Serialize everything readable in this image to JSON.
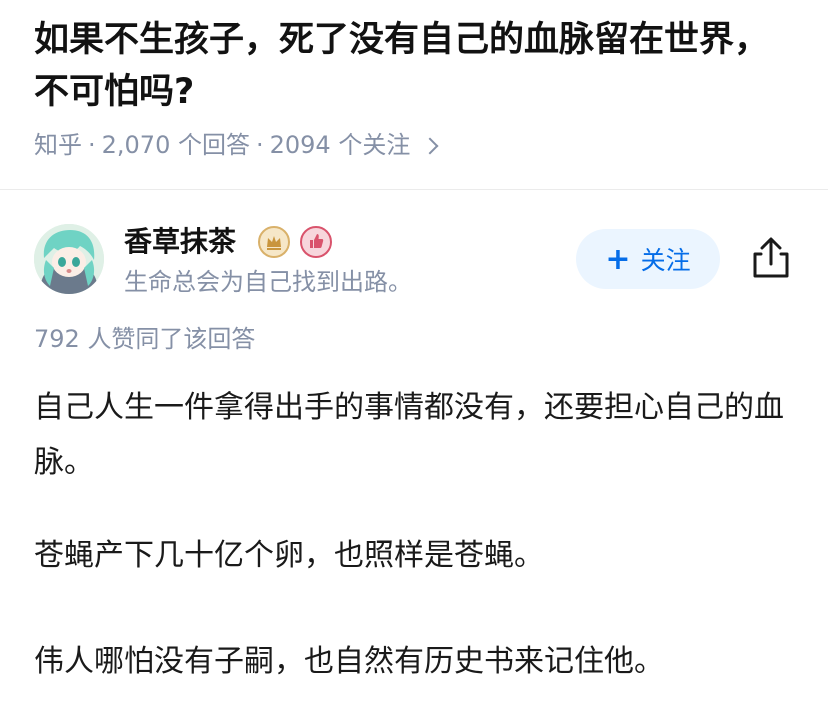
{
  "question": {
    "title": "如果不生孩子，死了没有自己的血脉留在世界，不可怕吗?",
    "source": "知乎",
    "answer_count": "2,070 个回答",
    "follow_count": "2094 个关注",
    "separator": "·"
  },
  "author": {
    "name": "香草抹茶",
    "bio": "生命总会为自己找到出路。",
    "badges": [
      "crown-badge-icon",
      "thumb-badge-icon"
    ]
  },
  "actions": {
    "follow_label": "关注",
    "follow_plus": "+",
    "share_icon": "share-icon"
  },
  "answer": {
    "approval": "792 人赞同了该回答",
    "paragraphs": [
      "自己人生一件拿得出手的事情都没有，还要担心自己的血脉。",
      "苍蝇产下几十亿个卵，也照样是苍蝇。",
      "伟人哪怕没有子嗣，也自然有历史书来记住他。"
    ]
  },
  "colors": {
    "accent": "#056de8",
    "follow_bg": "#ebf5ff",
    "meta_text": "#8590a6"
  }
}
